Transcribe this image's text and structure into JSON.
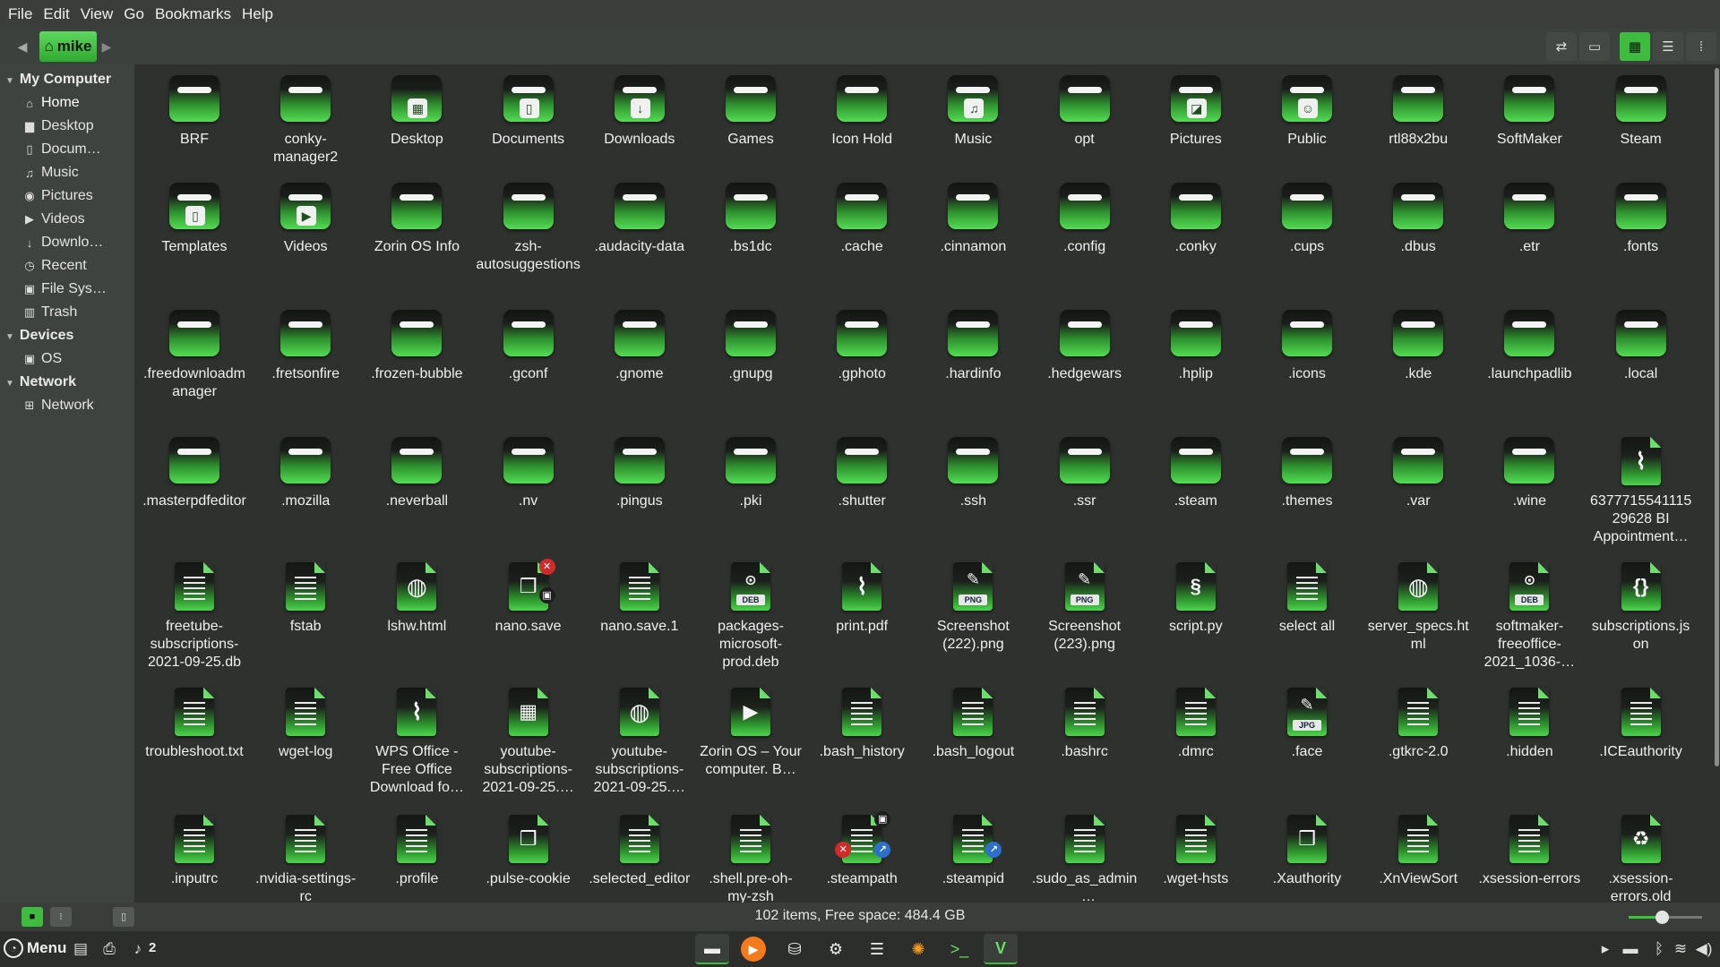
{
  "menubar": {
    "items": [
      "File",
      "Edit",
      "View",
      "Go",
      "Bookmarks",
      "Help"
    ]
  },
  "toolbar": {
    "breadcrumb": "mike",
    "view_buttons": [
      "toggle-location-icon",
      "split-view-icon",
      "icon-view-icon",
      "list-view-icon",
      "compact-view-icon"
    ],
    "active_view": "icon-view"
  },
  "sidebar": {
    "sections": [
      {
        "title": "My Computer",
        "items": [
          {
            "label": "Home",
            "icon": "home-icon"
          },
          {
            "label": "Desktop",
            "icon": "folder-icon"
          },
          {
            "label": "Docum…",
            "icon": "document-icon"
          },
          {
            "label": "Music",
            "icon": "music-icon"
          },
          {
            "label": "Pictures",
            "icon": "camera-icon"
          },
          {
            "label": "Videos",
            "icon": "video-icon"
          },
          {
            "label": "Downlo…",
            "icon": "download-icon"
          },
          {
            "label": "Recent",
            "icon": "recent-icon"
          },
          {
            "label": "File Sys…",
            "icon": "drive-icon"
          },
          {
            "label": "Trash",
            "icon": "trash-icon"
          }
        ]
      },
      {
        "title": "Devices",
        "items": [
          {
            "label": "OS",
            "icon": "drive-icon"
          }
        ]
      },
      {
        "title": "Network",
        "items": [
          {
            "label": "Network",
            "icon": "network-icon"
          }
        ]
      }
    ]
  },
  "files": [
    {
      "name": "BRF",
      "kind": "folder"
    },
    {
      "name": "conky-manager2",
      "kind": "folder"
    },
    {
      "name": "Desktop",
      "kind": "folder",
      "emblem": "desktop"
    },
    {
      "name": "Documents",
      "kind": "folder",
      "emblem": "document"
    },
    {
      "name": "Downloads",
      "kind": "folder",
      "emblem": "download"
    },
    {
      "name": "Games",
      "kind": "folder"
    },
    {
      "name": "Icon Hold",
      "kind": "folder"
    },
    {
      "name": "Music",
      "kind": "folder",
      "emblem": "music"
    },
    {
      "name": "opt",
      "kind": "folder"
    },
    {
      "name": "Pictures",
      "kind": "folder",
      "emblem": "picture"
    },
    {
      "name": "Public",
      "kind": "folder",
      "emblem": "people"
    },
    {
      "name": "rtl88x2bu",
      "kind": "folder"
    },
    {
      "name": "SoftMaker",
      "kind": "folder"
    },
    {
      "name": "Steam",
      "kind": "folder"
    },
    {
      "name": "Templates",
      "kind": "folder",
      "emblem": "document"
    },
    {
      "name": "Videos",
      "kind": "folder",
      "emblem": "video"
    },
    {
      "name": "Zorin OS Info",
      "kind": "folder"
    },
    {
      "name": "zsh-autosuggestions",
      "kind": "folder"
    },
    {
      "name": ".audacity-data",
      "kind": "folder"
    },
    {
      "name": ".bs1dc",
      "kind": "folder"
    },
    {
      "name": ".cache",
      "kind": "folder"
    },
    {
      "name": ".cinnamon",
      "kind": "folder"
    },
    {
      "name": ".config",
      "kind": "folder"
    },
    {
      "name": ".conky",
      "kind": "folder"
    },
    {
      "name": ".cups",
      "kind": "folder"
    },
    {
      "name": ".dbus",
      "kind": "folder"
    },
    {
      "name": ".etr",
      "kind": "folder"
    },
    {
      "name": ".fonts",
      "kind": "folder"
    },
    {
      "name": ".freedownloadmanager",
      "kind": "folder"
    },
    {
      "name": ".fretsonfire",
      "kind": "folder"
    },
    {
      "name": ".frozen-bubble",
      "kind": "folder"
    },
    {
      "name": ".gconf",
      "kind": "folder"
    },
    {
      "name": ".gnome",
      "kind": "folder"
    },
    {
      "name": ".gnupg",
      "kind": "folder"
    },
    {
      "name": ".gphoto",
      "kind": "folder"
    },
    {
      "name": ".hardinfo",
      "kind": "folder"
    },
    {
      "name": ".hedgewars",
      "kind": "folder"
    },
    {
      "name": ".hplip",
      "kind": "folder"
    },
    {
      "name": ".icons",
      "kind": "folder"
    },
    {
      "name": ".kde",
      "kind": "folder"
    },
    {
      "name": ".launchpadlib",
      "kind": "folder"
    },
    {
      "name": ".local",
      "kind": "folder"
    },
    {
      "name": ".masterpdfeditor",
      "kind": "folder"
    },
    {
      "name": ".mozilla",
      "kind": "folder"
    },
    {
      "name": ".neverball",
      "kind": "folder"
    },
    {
      "name": ".nv",
      "kind": "folder"
    },
    {
      "name": ".pingus",
      "kind": "folder"
    },
    {
      "name": ".pki",
      "kind": "folder"
    },
    {
      "name": ".shutter",
      "kind": "folder"
    },
    {
      "name": ".ssh",
      "kind": "folder"
    },
    {
      "name": ".ssr",
      "kind": "folder"
    },
    {
      "name": ".steam",
      "kind": "folder"
    },
    {
      "name": ".themes",
      "kind": "folder"
    },
    {
      "name": ".var",
      "kind": "folder"
    },
    {
      "name": ".wine",
      "kind": "folder"
    },
    {
      "name": "637771554111529628 BI Appointment…",
      "kind": "pdf"
    },
    {
      "name": "freetube-subscriptions-2021-09-25.db",
      "kind": "text"
    },
    {
      "name": "fstab",
      "kind": "text"
    },
    {
      "name": "lshw.html",
      "kind": "html"
    },
    {
      "name": "nano.save",
      "kind": "package",
      "badges": [
        "x",
        "lock"
      ]
    },
    {
      "name": "nano.save.1",
      "kind": "text"
    },
    {
      "name": "packages-microsoft-prod.deb",
      "kind": "deb"
    },
    {
      "name": "print.pdf",
      "kind": "pdf"
    },
    {
      "name": "Screenshot (222).png",
      "kind": "png"
    },
    {
      "name": "Screenshot (223).png",
      "kind": "png"
    },
    {
      "name": "script.py",
      "kind": "python"
    },
    {
      "name": "select all",
      "kind": "text"
    },
    {
      "name": "server_specs.html",
      "kind": "html"
    },
    {
      "name": "softmaker-freeoffice-2021_1036-…",
      "kind": "deb"
    },
    {
      "name": "subscriptions.json",
      "kind": "json"
    },
    {
      "name": "troubleshoot.txt",
      "kind": "text"
    },
    {
      "name": "wget-log",
      "kind": "text"
    },
    {
      "name": "WPS Office - Free Office Download fo…",
      "kind": "pdf"
    },
    {
      "name": "youtube-subscriptions-2021-09-25.…",
      "kind": "spreadsheet"
    },
    {
      "name": "youtube-subscriptions-2021-09-25.…",
      "kind": "html"
    },
    {
      "name": "Zorin OS – Your computer. B…",
      "kind": "video"
    },
    {
      "name": ".bash_history",
      "kind": "text"
    },
    {
      "name": ".bash_logout",
      "kind": "text"
    },
    {
      "name": ".bashrc",
      "kind": "text"
    },
    {
      "name": ".dmrc",
      "kind": "text"
    },
    {
      "name": ".face",
      "kind": "jpg"
    },
    {
      "name": ".gtkrc-2.0",
      "kind": "text"
    },
    {
      "name": ".hidden",
      "kind": "text"
    },
    {
      "name": ".ICEauthority",
      "kind": "text"
    },
    {
      "name": ".inputrc",
      "kind": "text"
    },
    {
      "name": ".nvidia-settings-rc",
      "kind": "text"
    },
    {
      "name": ".profile",
      "kind": "text"
    },
    {
      "name": ".pulse-cookie",
      "kind": "package"
    },
    {
      "name": ".selected_editor",
      "kind": "text"
    },
    {
      "name": ".shell.pre-oh-my-zsh",
      "kind": "text"
    },
    {
      "name": ".steampath",
      "kind": "text",
      "badges": [
        "lock",
        "x",
        "link"
      ]
    },
    {
      "name": ".steampid",
      "kind": "text",
      "badges": [
        "link"
      ]
    },
    {
      "name": ".sudo_as_admin_…",
      "kind": "text"
    },
    {
      "name": ".wget-hsts",
      "kind": "text"
    },
    {
      "name": ".Xauthority",
      "kind": "package"
    },
    {
      "name": ".XnViewSort",
      "kind": "text"
    },
    {
      "name": ".xsession-errors",
      "kind": "text"
    },
    {
      "name": ".xsession-errors.old",
      "kind": "recycle"
    }
  ],
  "statusbar": {
    "text": "102 items, Free space: 484.4 GB",
    "zoom_level": 0.45
  },
  "panel": {
    "menu_label": "Menu",
    "notification_count": "2",
    "launchers": [
      "files-icon",
      "media-player-icon",
      "software-store-icon",
      "settings-icon",
      "text-editor-icon",
      "firefox-icon",
      "terminal-icon",
      "vivaldi-icon"
    ],
    "tray": [
      "terminal-tray-icon",
      "disk-tray-icon",
      "bluetooth-tray-icon",
      "wifi-icon",
      "volume-icon"
    ]
  }
}
